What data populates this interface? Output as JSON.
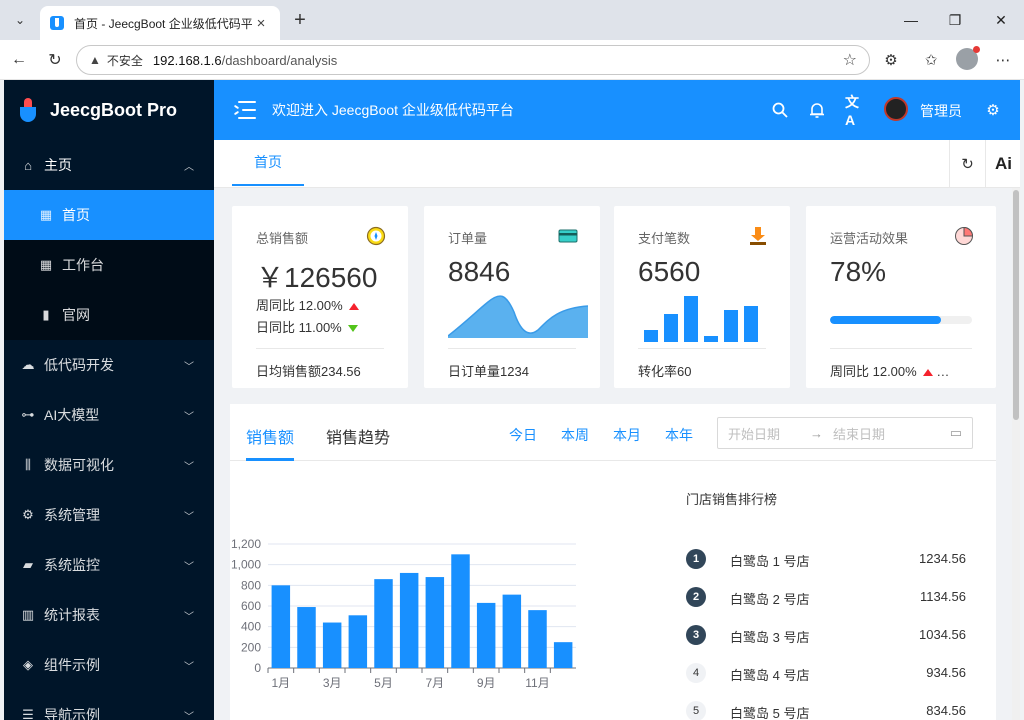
{
  "browser": {
    "tab_title": "首页 - JeecgBoot 企业级低代码平台",
    "address": {
      "insecure_label": "不安全",
      "host": "192.168.1.6",
      "path": "/dashboard/analysis"
    }
  },
  "sidebar": {
    "brand": "JeecgBoot Pro",
    "items": [
      {
        "label": "主页",
        "icon": "home-icon",
        "open": true,
        "children": [
          {
            "label": "首页",
            "icon": "grid-icon",
            "active": true
          },
          {
            "label": "工作台",
            "icon": "grid-icon"
          },
          {
            "label": "官网",
            "icon": "book-icon"
          }
        ]
      },
      {
        "label": "低代码开发",
        "icon": "cloud-icon"
      },
      {
        "label": "AI大模型",
        "icon": "ai-icon"
      },
      {
        "label": "数据可视化",
        "icon": "chart-icon"
      },
      {
        "label": "系统管理",
        "icon": "gear-icon"
      },
      {
        "label": "系统监控",
        "icon": "monitor-icon"
      },
      {
        "label": "统计报表",
        "icon": "report-icon"
      },
      {
        "label": "组件示例",
        "icon": "layers-icon"
      },
      {
        "label": "导航示例",
        "icon": "nav-icon"
      }
    ]
  },
  "header": {
    "welcome": "欢迎进入 JeecgBoot 企业级低代码平台",
    "user": "管理员"
  },
  "tabs": {
    "home": "首页",
    "ai": "Ai"
  },
  "cards": {
    "total_sales": {
      "title": "总销售额",
      "value": "￥126560",
      "wow": "周同比 12.00%",
      "dod": "日同比 11.00%",
      "footer": "日均销售额234.56"
    },
    "orders": {
      "title": "订单量",
      "value": "8846",
      "footer": "日订单量1234"
    },
    "payments": {
      "title": "支付笔数",
      "value": "6560",
      "footer": "转化率60"
    },
    "ops": {
      "title": "运营活动效果",
      "value": "78%",
      "progress": 0.78,
      "footer": "周同比 12.00%"
    }
  },
  "sales_panel": {
    "tab_sales": "销售额",
    "tab_trend": "销售趋势",
    "ranges": [
      "今日",
      "本周",
      "本月",
      "本年"
    ],
    "date_start_placeholder": "开始日期",
    "date_end_placeholder": "结束日期",
    "rank_title": "门店销售排行榜",
    "rank": [
      {
        "num": "1",
        "name": "白鹭岛 1 号店",
        "value": "1234.56"
      },
      {
        "num": "2",
        "name": "白鹭岛 2 号店",
        "value": "1134.56"
      },
      {
        "num": "3",
        "name": "白鹭岛 3 号店",
        "value": "1034.56"
      },
      {
        "num": "4",
        "name": "白鹭岛 4 号店",
        "value": "934.56"
      },
      {
        "num": "5",
        "name": "白鹭岛 5 号店",
        "value": "834.56"
      }
    ]
  },
  "colors": {
    "primary": "#1890ff",
    "sidebar": "#001529",
    "up": "#f5222d",
    "down": "#52c41a"
  },
  "chart_data": {
    "type": "bar",
    "categories": [
      "1月",
      "2月",
      "3月",
      "4月",
      "5月",
      "6月",
      "7月",
      "8月",
      "9月",
      "10月",
      "11月",
      "12月"
    ],
    "tick_labels_x": [
      "1月",
      "3月",
      "5月",
      "7月",
      "9月",
      "11月"
    ],
    "values": [
      800,
      590,
      440,
      510,
      860,
      920,
      880,
      1100,
      630,
      710,
      560,
      250
    ],
    "ylim": [
      0,
      1200
    ],
    "y_ticks": [
      "0",
      "200",
      "400",
      "600",
      "800",
      "1,000",
      "1,200"
    ],
    "grid": true,
    "color": "#1890ff"
  }
}
